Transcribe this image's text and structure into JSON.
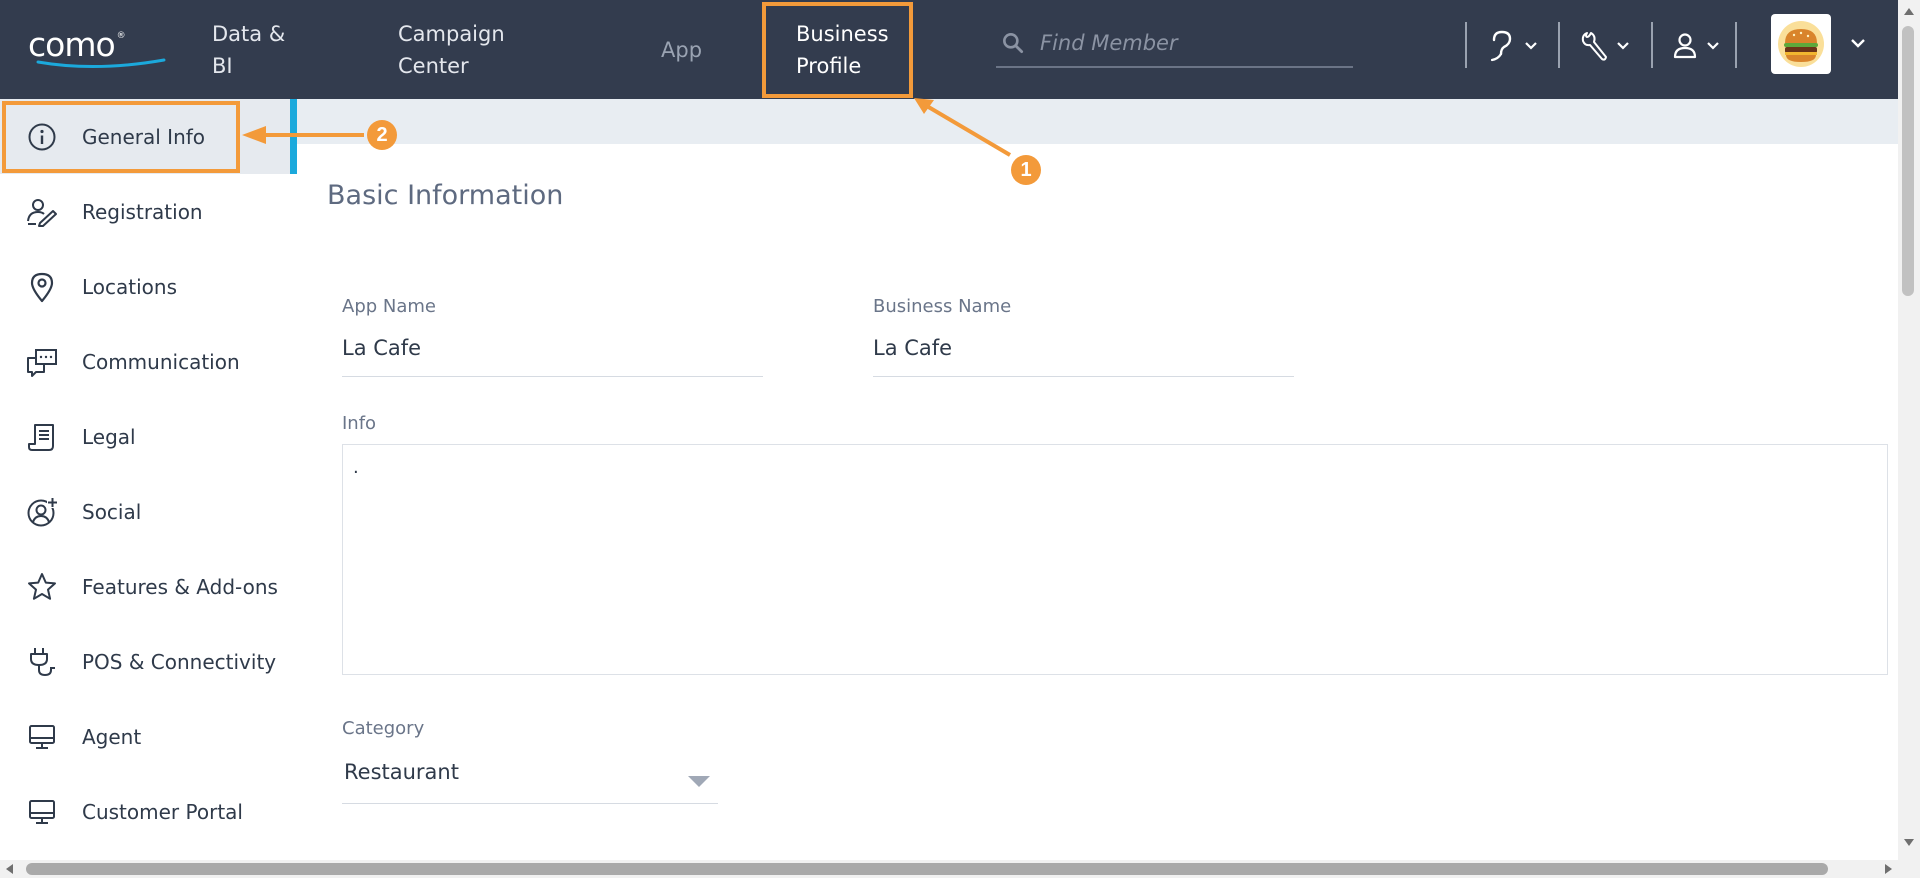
{
  "header": {
    "logo": "como",
    "nav": [
      {
        "label": "Data &\nBI"
      },
      {
        "label": "Campaign\nCenter"
      },
      {
        "label": "App"
      },
      {
        "label": "Business\nProfile"
      }
    ],
    "search": {
      "placeholder": "Find Member",
      "icon": "search-icon"
    },
    "tools": [
      {
        "icon": "help-icon"
      },
      {
        "icon": "wrench-icon"
      },
      {
        "icon": "user-icon"
      }
    ],
    "avatar": {
      "icon": "burger-logo-icon"
    }
  },
  "annotations": {
    "badge_1": "1",
    "badge_2": "2"
  },
  "sidebar": {
    "items": [
      {
        "label": "General Info",
        "icon": "info-icon",
        "active": true
      },
      {
        "label": "Registration",
        "icon": "registration-icon"
      },
      {
        "label": "Locations",
        "icon": "location-pin-icon"
      },
      {
        "label": "Communication",
        "icon": "chat-icon"
      },
      {
        "label": "Legal",
        "icon": "document-icon"
      },
      {
        "label": "Social",
        "icon": "social-icon"
      },
      {
        "label": "Features & Add-ons",
        "icon": "star-icon"
      },
      {
        "label": "POS & Connectivity",
        "icon": "plug-icon"
      },
      {
        "label": "Agent",
        "icon": "monitor-icon"
      },
      {
        "label": "Customer Portal",
        "icon": "monitor-icon"
      }
    ]
  },
  "main": {
    "section_title": "Basic Information",
    "app_name": {
      "label": "App Name",
      "value": "La Cafe"
    },
    "business_name": {
      "label": "Business Name",
      "value": "La Cafe"
    },
    "info": {
      "label": "Info",
      "value": "."
    },
    "category": {
      "label": "Category",
      "value": "Restaurant"
    }
  },
  "colors": {
    "topbar": "#333c4e",
    "accent": "#1ba9dc",
    "annotation": "#f39a3a"
  }
}
